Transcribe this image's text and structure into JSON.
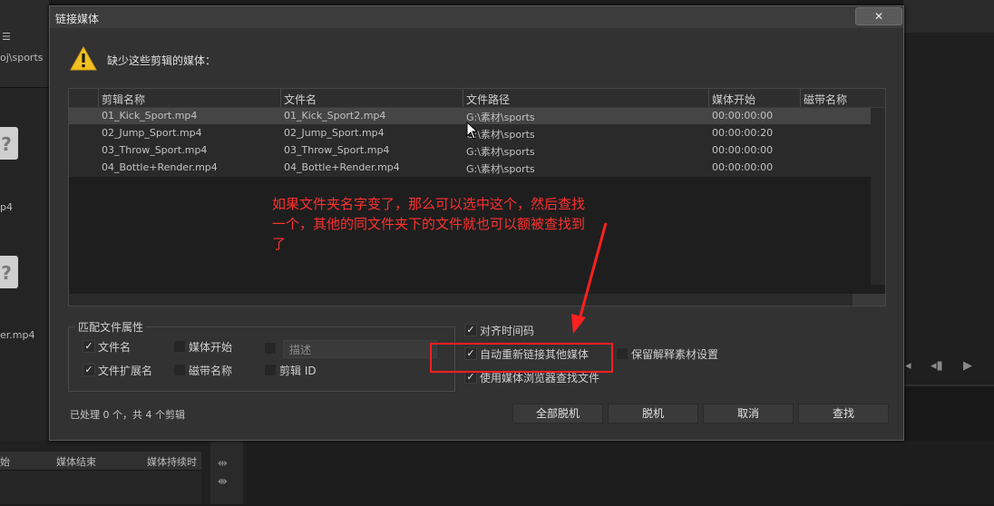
{
  "background": {
    "left_panel_path": "oj\\sports",
    "left_panel_menu_icon": "menu-lines-icon",
    "left_file_label_1": "p4",
    "left_file_label_2": "er.mp4",
    "bottom_col_headers": [
      "始",
      "媒体结束",
      "媒体持续时"
    ]
  },
  "dialog": {
    "title": "链接媒体",
    "close_label": "✕",
    "missing_label": "缺少这些剪辑的媒体：",
    "table": {
      "headers": [
        "剪辑名称",
        "文件名",
        "文件路径",
        "媒体开始",
        "磁带名称"
      ],
      "rows": [
        {
          "clip": "01_Kick_Sport.mp4",
          "file": "01_Kick_Sport2.mp4",
          "path": "G:\\素材\\sports",
          "start": "00:00:00:00",
          "tape": ""
        },
        {
          "clip": "02_Jump_Sport.mp4",
          "file": "02_Jump_Sport.mp4",
          "path": "G:\\素材\\sports",
          "start": "00:00:00:20",
          "tape": ""
        },
        {
          "clip": "03_Throw_Sport.mp4",
          "file": "03_Throw_Sport.mp4",
          "path": "G:\\素材\\sports",
          "start": "00:00:00:00",
          "tape": ""
        },
        {
          "clip": "04_Bottle+Render.mp4",
          "file": "04_Bottle+Render.mp4",
          "path": "G:\\素材\\sports",
          "start": "00:00:00:00",
          "tape": ""
        }
      ]
    },
    "match_group": {
      "title": "匹配文件属性",
      "file_name": {
        "label": "文件名",
        "checked": true
      },
      "file_ext": {
        "label": "文件扩展名",
        "checked": true
      },
      "media_start": {
        "label": "媒体开始",
        "checked": false
      },
      "tape_name": {
        "label": "磁带名称",
        "checked": false
      },
      "description": {
        "label": "描述",
        "checked": false
      },
      "clip_id": {
        "label": "剪辑 ID",
        "checked": false
      }
    },
    "options": {
      "align_timecode": {
        "label": "对齐时间码",
        "checked": true
      },
      "auto_relink": {
        "label": "自动重新链接其他媒体",
        "checked": true
      },
      "preserve_interpret": {
        "label": "保留解释素材设置",
        "checked": false
      },
      "use_media_browser": {
        "label": "使用媒体浏览器查找文件",
        "checked": true
      }
    },
    "status": "已处理 0 个，共 4 个剪辑",
    "buttons": {
      "offline_all": "全部脱机",
      "offline": "脱机",
      "cancel": "取消",
      "locate": "查找"
    }
  },
  "annotation": {
    "text": "如果文件夹名字变了，那么可以选中这个，然后查找一个，其他的同文件夹下的文件就也可以额被查找到了",
    "color": "#ff3030"
  },
  "colors": {
    "dialog_bg": "#323232",
    "accent_red": "#ff2020"
  }
}
